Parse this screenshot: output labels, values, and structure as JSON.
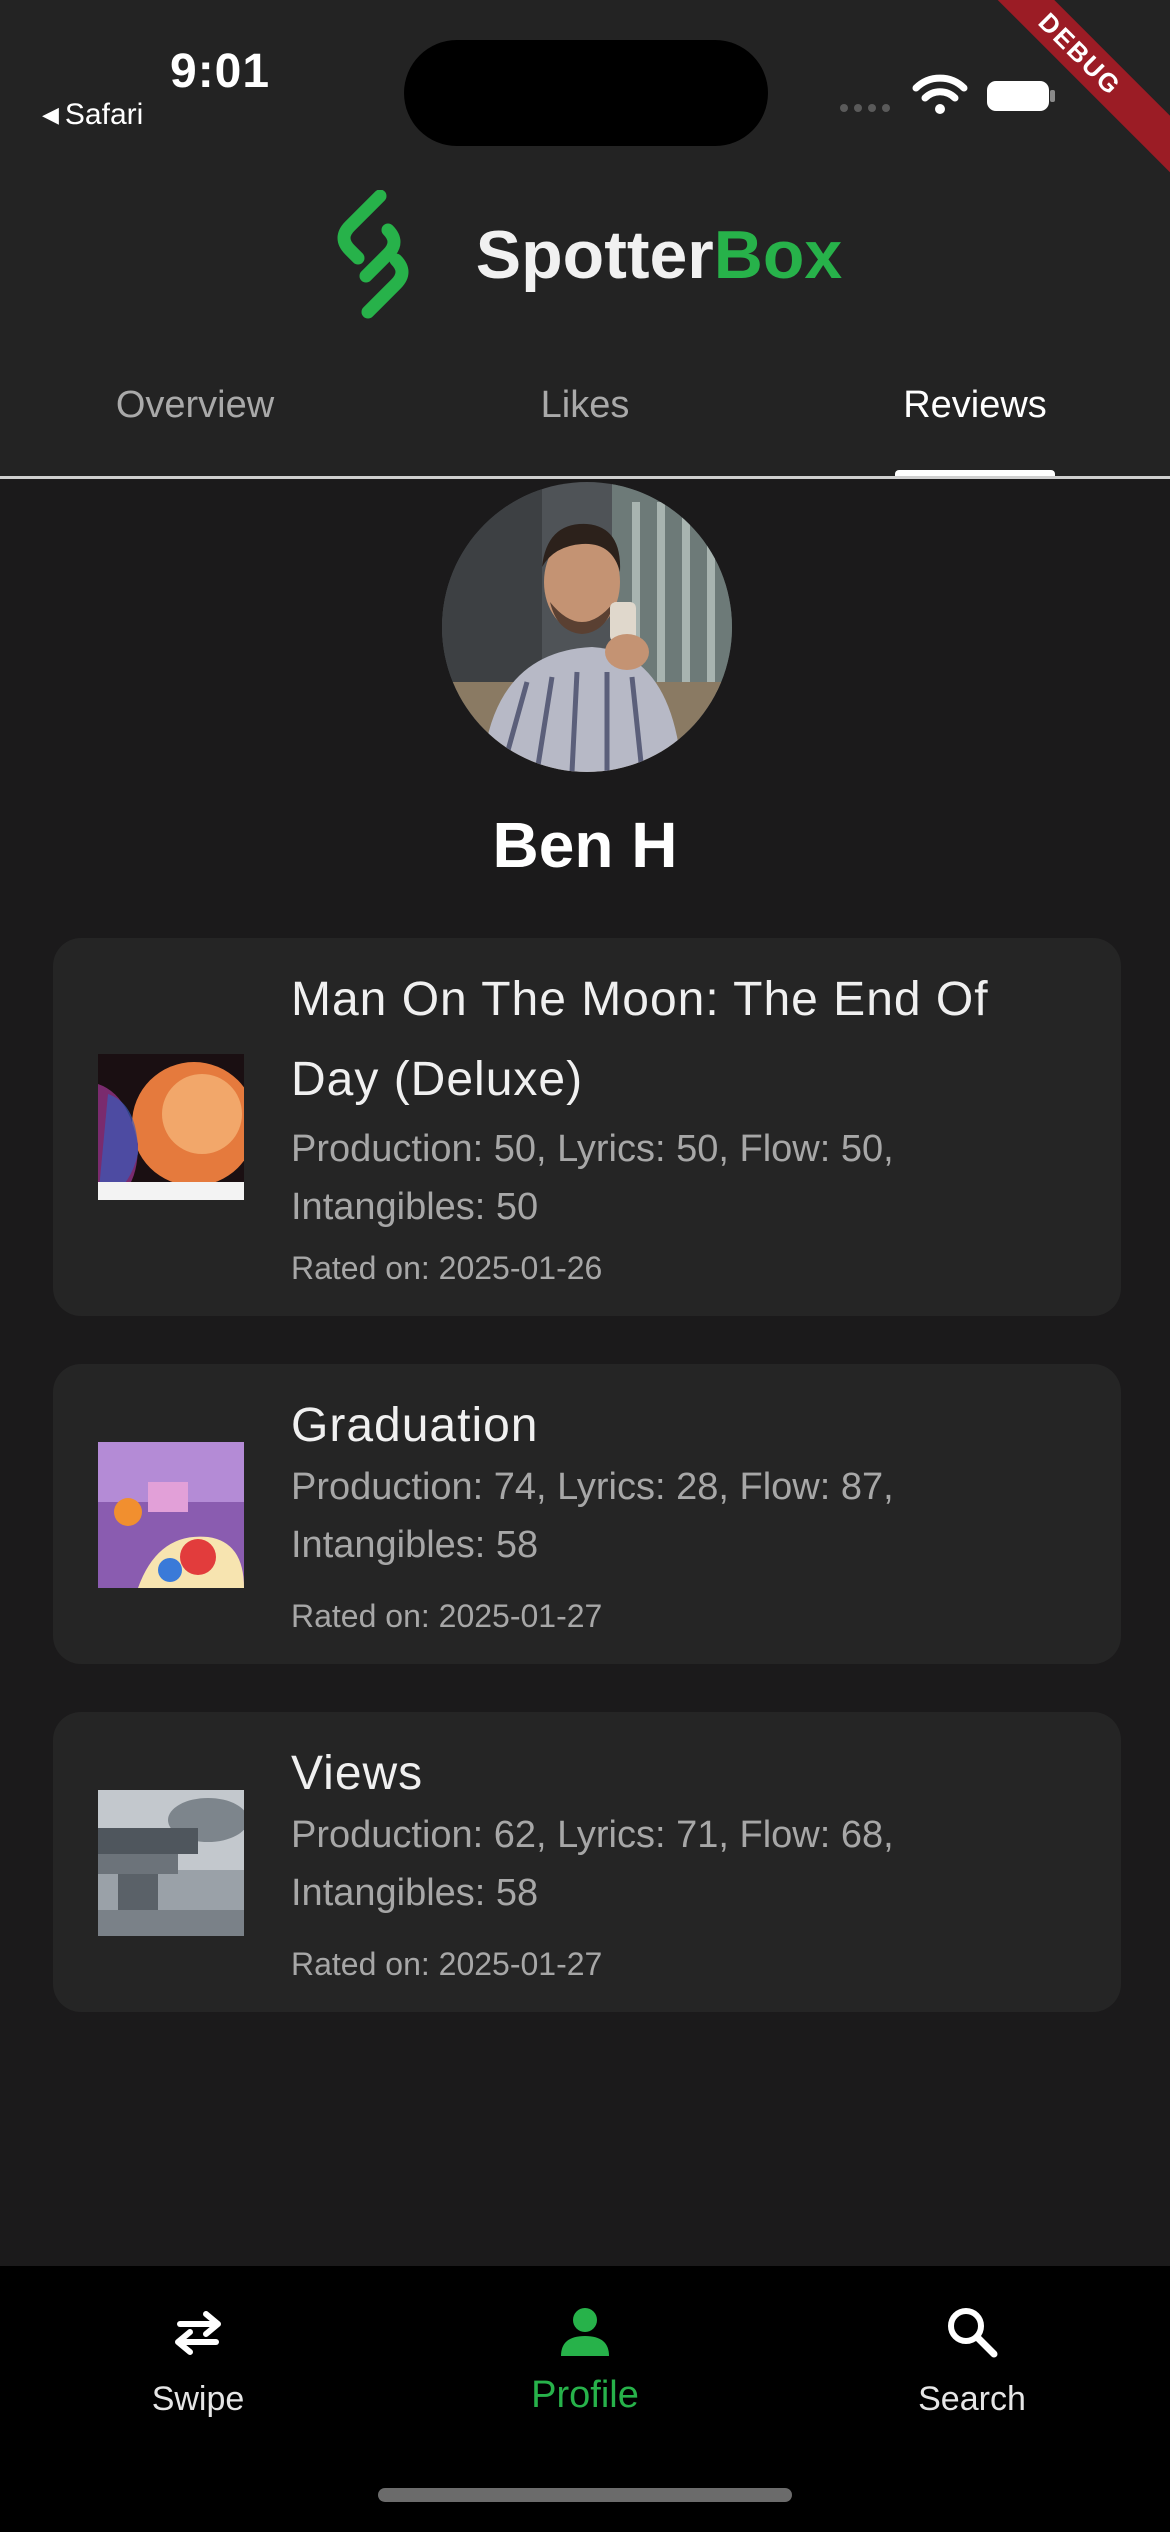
{
  "status_bar": {
    "time": "9:01",
    "back_app": "Safari",
    "debug_label": "DEBUG"
  },
  "header": {
    "brand_primary": "Spotter",
    "brand_accent": "Box",
    "accent_color": "#27b24a"
  },
  "tabs": [
    {
      "label": "Overview",
      "active": false
    },
    {
      "label": "Likes",
      "active": false
    },
    {
      "label": "Reviews",
      "active": true
    }
  ],
  "profile": {
    "name": "Ben H",
    "avatar_icon": "user-photo"
  },
  "reviews": [
    {
      "title": "Man On The Moon: The End Of Day (Deluxe)",
      "ratings": "Production: 50, Lyrics: 50, Flow: 50, Intangibles: 50",
      "date": "Rated on: 2025-01-26"
    },
    {
      "title": "Graduation",
      "ratings": "Production: 74, Lyrics: 28, Flow: 87, Intangibles: 58",
      "date": "Rated on: 2025-01-27"
    },
    {
      "title": "Views",
      "ratings": "Production: 62, Lyrics: 71, Flow: 68, Intangibles: 58",
      "date": "Rated on: 2025-01-27"
    }
  ],
  "bottom_nav": [
    {
      "label": "Swipe",
      "icon": "swap-arrows-icon",
      "active": false
    },
    {
      "label": "Profile",
      "icon": "person-icon",
      "active": true
    },
    {
      "label": "Search",
      "icon": "search-icon",
      "active": false
    }
  ]
}
